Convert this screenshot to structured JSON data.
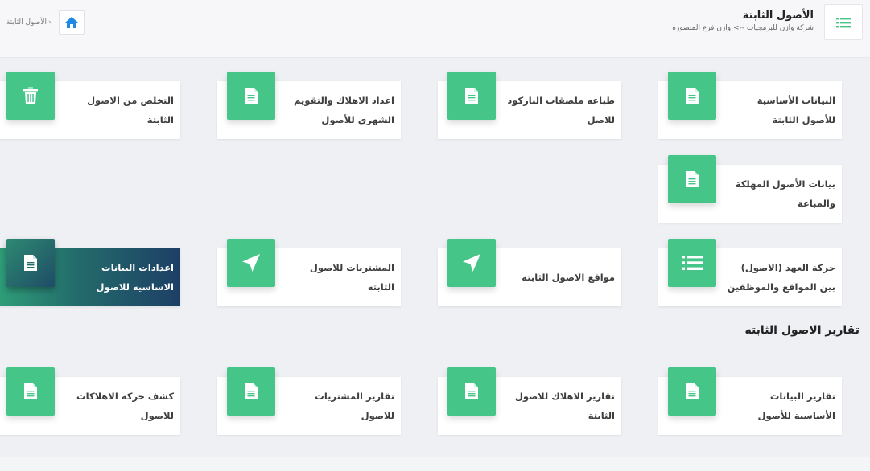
{
  "header": {
    "title": "الأصول الثابتة",
    "subtitle": "شركة وازن للبرمجيات --> وازن فرع المنصوره",
    "menu_icon": "list-icon",
    "home_icon": "home-icon",
    "breadcrumb_separator": "›",
    "breadcrumb_current": "الأصول الثابتة"
  },
  "colors": {
    "accent": "#45c587",
    "dark_card_start": "#2e9f78",
    "dark_card_end": "#1d3f66",
    "home_icon": "#1e88e5"
  },
  "cards": [
    {
      "label": "البيانات الأساسية للأصول الثابتة",
      "icon": "document-icon"
    },
    {
      "label": "طباعه ملصقات الباركود للاصل",
      "icon": "document-icon"
    },
    {
      "label": "اعداد الاهلاك والتقويم الشهرى للأصول",
      "icon": "document-icon"
    },
    {
      "label": "التخلص من الاصول الثابتة",
      "icon": "trash-icon"
    },
    {
      "label": "بيانات الأصول المهلكة والمباعة",
      "icon": "document-icon"
    },
    {
      "label": "حركة العهد (الاصول) بين المواقع والموظفين",
      "icon": "list-icon"
    },
    {
      "label": "مواقع الاصول الثابته",
      "icon": "location-arrow-icon"
    },
    {
      "label": "المشتريات للاصول الثابته",
      "icon": "location-arrow-icon"
    },
    {
      "label": "اعدادات البيانات الاساسيه للاصول",
      "icon": "document-icon"
    }
  ],
  "reports_section": {
    "title": "تقارير الاصول الثابته",
    "cards": [
      {
        "label": "تقارير البيانات الأساسية للأصول",
        "icon": "document-icon"
      },
      {
        "label": "تقارير الاهلاك للاصول الثابتة",
        "icon": "document-icon"
      },
      {
        "label": "تقارير المشتريات للاصول",
        "icon": "document-icon"
      },
      {
        "label": "كشف حركه الاهلاكات للاصول",
        "icon": "document-icon"
      }
    ]
  }
}
